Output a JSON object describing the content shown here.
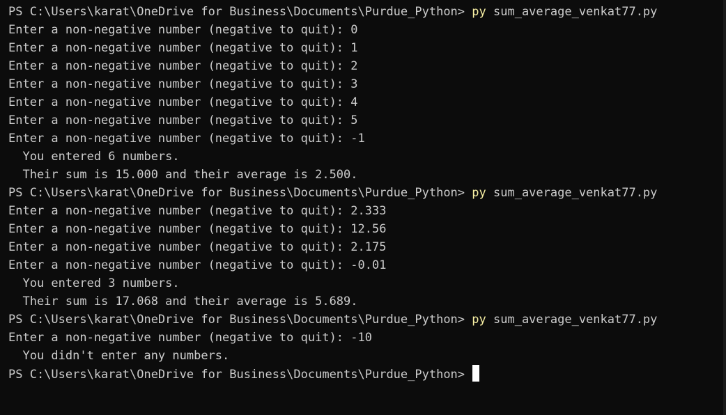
{
  "terminal": {
    "colors": {
      "background": "#0c0c0c",
      "text": "#cccccc",
      "command": "#f9f1a5",
      "cursor": "#ffffff"
    },
    "session": [
      {
        "type": "prompt",
        "path": "PS C:\\Users\\karat\\OneDrive for Business\\Documents\\Purdue_Python> ",
        "cmd": "py",
        "args": " sum_average_venkat77.py"
      },
      {
        "type": "output",
        "text": "Enter a non-negative number (negative to quit): 0"
      },
      {
        "type": "output",
        "text": "Enter a non-negative number (negative to quit): 1"
      },
      {
        "type": "output",
        "text": "Enter a non-negative number (negative to quit): 2"
      },
      {
        "type": "output",
        "text": "Enter a non-negative number (negative to quit): 3"
      },
      {
        "type": "output",
        "text": "Enter a non-negative number (negative to quit): 4"
      },
      {
        "type": "output",
        "text": "Enter a non-negative number (negative to quit): 5"
      },
      {
        "type": "output",
        "text": "Enter a non-negative number (negative to quit): -1"
      },
      {
        "type": "output",
        "text": "  You entered 6 numbers."
      },
      {
        "type": "output",
        "text": "  Their sum is 15.000 and their average is 2.500."
      },
      {
        "type": "prompt",
        "path": "PS C:\\Users\\karat\\OneDrive for Business\\Documents\\Purdue_Python> ",
        "cmd": "py",
        "args": " sum_average_venkat77.py"
      },
      {
        "type": "output",
        "text": "Enter a non-negative number (negative to quit): 2.333"
      },
      {
        "type": "output",
        "text": "Enter a non-negative number (negative to quit): 12.56"
      },
      {
        "type": "output",
        "text": "Enter a non-negative number (negative to quit): 2.175"
      },
      {
        "type": "output",
        "text": "Enter a non-negative number (negative to quit): -0.01"
      },
      {
        "type": "output",
        "text": "  You entered 3 numbers."
      },
      {
        "type": "output",
        "text": "  Their sum is 17.068 and their average is 5.689."
      },
      {
        "type": "prompt",
        "path": "PS C:\\Users\\karat\\OneDrive for Business\\Documents\\Purdue_Python> ",
        "cmd": "py",
        "args": " sum_average_venkat77.py"
      },
      {
        "type": "output",
        "text": "Enter a non-negative number (negative to quit): -10"
      },
      {
        "type": "output",
        "text": "  You didn't enter any numbers."
      }
    ],
    "current_prompt": "PS C:\\Users\\karat\\OneDrive for Business\\Documents\\Purdue_Python> "
  }
}
